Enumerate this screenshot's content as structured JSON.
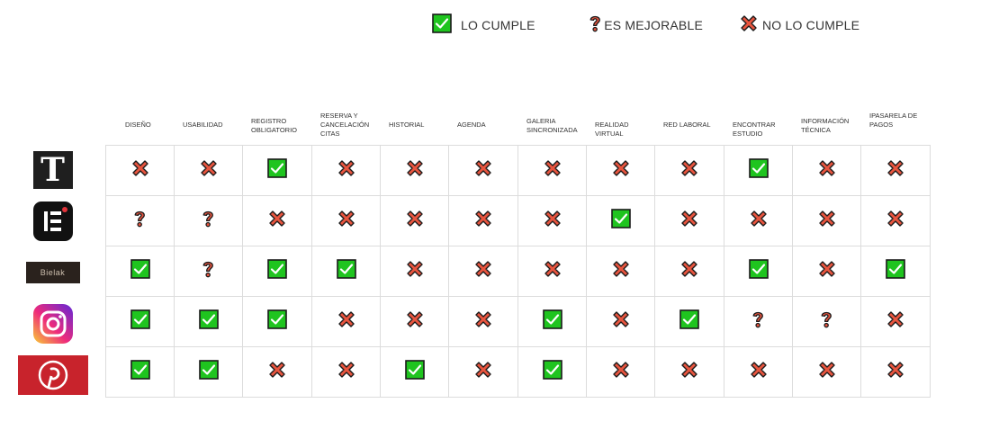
{
  "legend": [
    {
      "icon": "check",
      "label": "LO CUMPLE"
    },
    {
      "icon": "question",
      "label": "ES MEJORABLE"
    },
    {
      "icon": "cross",
      "label": "NO LO CUMPLE"
    }
  ],
  "columns": [
    "DISEÑO",
    "USABILIDAD",
    "REGISTRO OBLIGATORIO",
    "RESERVA Y CANCELACIÓN CITAS",
    "HISTORIAL",
    "AGENDA",
    "GALERIA SINCRONIZADA",
    "REALIDAD VIRTUAL",
    "RED LABORAL",
    "ENCONTRAR ESTUDIO",
    "INFORMACIÓN TÉCNICA",
    "IPASARELA DE PAGOS"
  ],
  "rows": [
    {
      "logo": "tattoodo-logo",
      "cells": [
        "cross",
        "cross",
        "check",
        "cross",
        "cross",
        "cross",
        "cross",
        "cross",
        "cross",
        "check",
        "cross",
        "cross"
      ]
    },
    {
      "logo": "elementor-logo",
      "cells": [
        "question",
        "question",
        "cross",
        "cross",
        "cross",
        "cross",
        "cross",
        "check",
        "cross",
        "cross",
        "cross",
        "cross"
      ]
    },
    {
      "logo": "bielak-logo",
      "logo_text": "Bielak",
      "cells": [
        "check",
        "question",
        "check",
        "check",
        "cross",
        "cross",
        "cross",
        "cross",
        "cross",
        "check",
        "cross",
        "check"
      ]
    },
    {
      "logo": "instagram-logo",
      "cells": [
        "check",
        "check",
        "check",
        "cross",
        "cross",
        "cross",
        "check",
        "cross",
        "check",
        "question",
        "question",
        "cross"
      ]
    },
    {
      "logo": "pinterest-logo",
      "cells": [
        "check",
        "check",
        "cross",
        "cross",
        "check",
        "cross",
        "check",
        "cross",
        "cross",
        "cross",
        "cross",
        "cross"
      ]
    }
  ],
  "colors": {
    "check_fill": "#1fc41f",
    "cross_fill": "#e8553f",
    "question_fill": "#e8553f",
    "outline": "#1a1a1a",
    "grid_border": "#dcdcdc"
  }
}
